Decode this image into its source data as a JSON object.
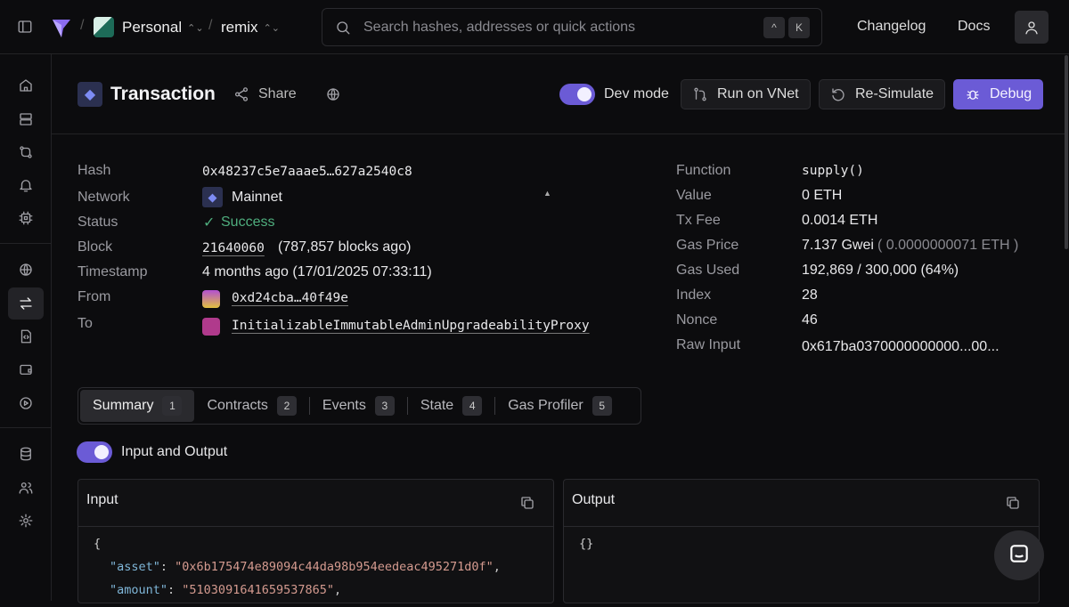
{
  "topbar": {
    "workspace": "Personal",
    "project": "remix",
    "search_placeholder": "Search hashes, addresses or quick actions",
    "kbd1": "^",
    "kbd2": "K",
    "changelog": "Changelog",
    "docs": "Docs"
  },
  "header": {
    "title": "Transaction",
    "share": "Share",
    "dev_mode": "Dev mode",
    "run_vnet": "Run on VNet",
    "resimulate": "Re-Simulate",
    "debug": "Debug"
  },
  "details_left": [
    {
      "label": "Hash",
      "value": "0x48237c5e7aaae5…627a2540c8"
    },
    {
      "label": "Network",
      "value": "Mainnet"
    },
    {
      "label": "Status",
      "value": "Success"
    },
    {
      "label": "Block",
      "value": "21640060",
      "extra": "(787,857 blocks ago)"
    },
    {
      "label": "Timestamp",
      "value": "4 months ago (17/01/2025 07:33:11)"
    },
    {
      "label": "From",
      "value": "0xd24cba…40f49e"
    },
    {
      "label": "To",
      "value": "InitializableImmutableAdminUpgradeabilityProxy"
    }
  ],
  "details_right": [
    {
      "label": "Function",
      "value": "supply()"
    },
    {
      "label": "Value",
      "value": "0 ETH"
    },
    {
      "label": "Tx Fee",
      "value": "0.0014 ETH"
    },
    {
      "label": "Gas Price",
      "value": "7.137 Gwei",
      "extra": "( 0.0000000071 ETH )"
    },
    {
      "label": "Gas Used",
      "value": "192,869 / 300,000 (64%)"
    },
    {
      "label": "Index",
      "value": "28"
    },
    {
      "label": "Nonce",
      "value": "46"
    },
    {
      "label": "Raw Input",
      "value": "0x617ba0370000000000...00..."
    }
  ],
  "tabs": [
    {
      "label": "Summary",
      "count": "1"
    },
    {
      "label": "Contracts",
      "count": "2"
    },
    {
      "label": "Events",
      "count": "3"
    },
    {
      "label": "State",
      "count": "4"
    },
    {
      "label": "Gas Profiler",
      "count": "5"
    }
  ],
  "io_toggle": "Input and Output",
  "input": {
    "title": "Input",
    "open": "{",
    "k1": "\"asset\"",
    "v1": "\"0x6b175474e89094c44da98b954eedeac495271d0f\"",
    "k2": "\"amount\"",
    "v2": "\"5103091641659537865\""
  },
  "output": {
    "title": "Output",
    "body": "{}"
  },
  "colors": {
    "accent": "#6b5bd6",
    "success": "#4fae7e"
  }
}
